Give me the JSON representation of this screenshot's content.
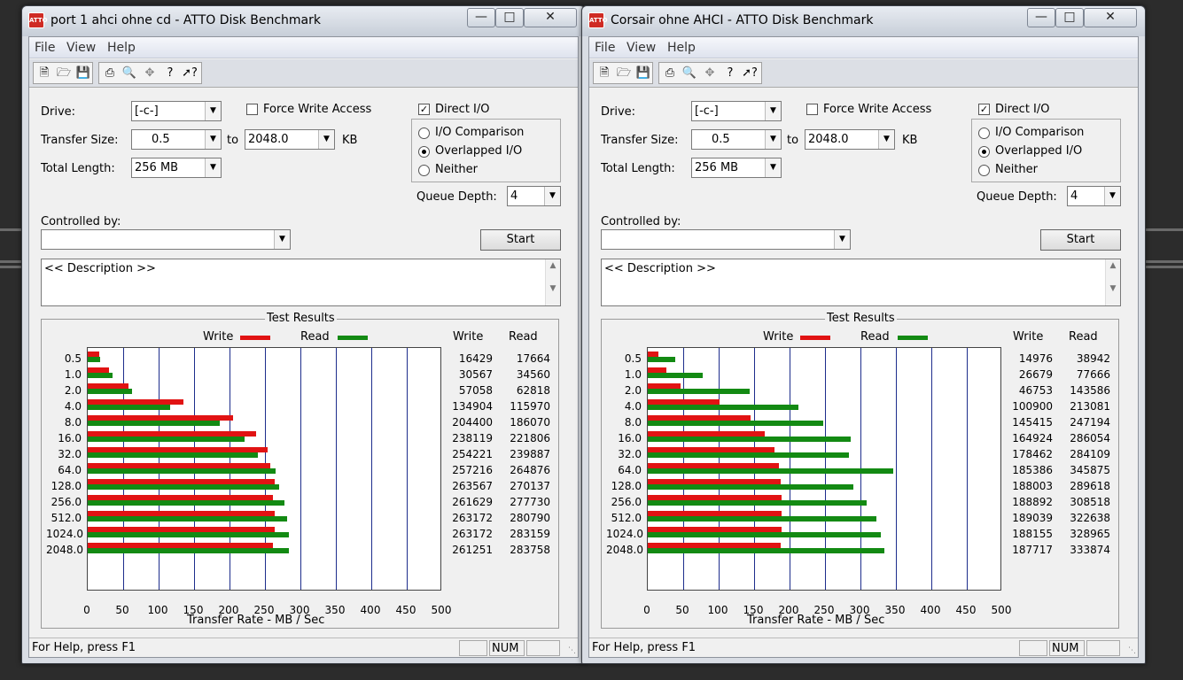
{
  "windows": [
    {
      "title": "port 1 ahci ohne cd - ATTO Disk Benchmark",
      "menu": [
        "File",
        "View",
        "Help"
      ],
      "drive_label": "Drive:",
      "drive_value": "[-c-]",
      "force_write_label": "Force Write Access",
      "force_write_checked": false,
      "direct_io_label": "Direct I/O",
      "direct_io_checked": true,
      "transfer_label": "Transfer Size:",
      "transfer_from": "0.5",
      "to_label": "to",
      "transfer_to": "2048.0",
      "kb_label": "KB",
      "length_label": "Total Length:",
      "length_value": "256 MB",
      "io_options": [
        "I/O Comparison",
        "Overlapped I/O",
        "Neither"
      ],
      "io_selected": 1,
      "queue_label": "Queue Depth:",
      "queue_value": "4",
      "controlled_label": "Controlled by:",
      "controlled_value": "",
      "start_label": "Start",
      "description": "<< Description >>",
      "results_title": "Test Results",
      "legend_write": "Write",
      "legend_read": "Read",
      "col_write": "Write",
      "col_read": "Read",
      "xlabel": "Transfer Rate - MB / Sec",
      "status_text": "For Help, press F1",
      "status_num": "NUM"
    },
    {
      "title": "Corsair ohne AHCI - ATTO Disk Benchmark",
      "menu": [
        "File",
        "View",
        "Help"
      ],
      "drive_label": "Drive:",
      "drive_value": "[-c-]",
      "force_write_label": "Force Write Access",
      "force_write_checked": false,
      "direct_io_label": "Direct I/O",
      "direct_io_checked": true,
      "transfer_label": "Transfer Size:",
      "transfer_from": "0.5",
      "to_label": "to",
      "transfer_to": "2048.0",
      "kb_label": "KB",
      "length_label": "Total Length:",
      "length_value": "256 MB",
      "io_options": [
        "I/O Comparison",
        "Overlapped I/O",
        "Neither"
      ],
      "io_selected": 1,
      "queue_label": "Queue Depth:",
      "queue_value": "4",
      "controlled_label": "Controlled by:",
      "controlled_value": "",
      "start_label": "Start",
      "description": "<< Description >>",
      "results_title": "Test Results",
      "legend_write": "Write",
      "legend_read": "Read",
      "col_write": "Write",
      "col_read": "Read",
      "xlabel": "Transfer Rate - MB / Sec",
      "status_text": "For Help, press F1",
      "status_num": "NUM"
    }
  ],
  "colors": {
    "write": "#e11313",
    "read": "#138a13"
  },
  "chart_data": [
    {
      "type": "bar",
      "title": "Test Results",
      "xlabel": "Transfer Rate - MB / Sec",
      "xlim": [
        0,
        500
      ],
      "xticks": [
        "0",
        "50",
        "100",
        "150",
        "200",
        "250",
        "300",
        "350",
        "400",
        "450",
        "500"
      ],
      "categories": [
        "0.5",
        "1.0",
        "2.0",
        "4.0",
        "8.0",
        "16.0",
        "32.0",
        "64.0",
        "128.0",
        "256.0",
        "512.0",
        "1024.0",
        "2048.0"
      ],
      "legend": "top",
      "series": [
        {
          "name": "Write",
          "values": [
            16429,
            30567,
            57058,
            134904,
            204400,
            238119,
            254221,
            257216,
            263567,
            261629,
            263172,
            263172,
            261251
          ]
        },
        {
          "name": "Read",
          "values": [
            17664,
            34560,
            62818,
            115970,
            186070,
            221806,
            239887,
            264876,
            270137,
            277730,
            280790,
            283159,
            283758
          ]
        }
      ]
    },
    {
      "type": "bar",
      "title": "Test Results",
      "xlabel": "Transfer Rate - MB / Sec",
      "xlim": [
        0,
        500
      ],
      "xticks": [
        "0",
        "50",
        "100",
        "150",
        "200",
        "250",
        "300",
        "350",
        "400",
        "450",
        "500"
      ],
      "categories": [
        "0.5",
        "1.0",
        "2.0",
        "4.0",
        "8.0",
        "16.0",
        "32.0",
        "64.0",
        "128.0",
        "256.0",
        "512.0",
        "1024.0",
        "2048.0"
      ],
      "legend": "top",
      "series": [
        {
          "name": "Write",
          "values": [
            14976,
            26679,
            46753,
            100900,
            145415,
            164924,
            178462,
            185386,
            188003,
            188892,
            189039,
            188155,
            187717
          ]
        },
        {
          "name": "Read",
          "values": [
            38942,
            77666,
            143586,
            213081,
            247194,
            286054,
            284109,
            345875,
            289618,
            308518,
            322638,
            328965,
            333874
          ]
        }
      ]
    }
  ]
}
